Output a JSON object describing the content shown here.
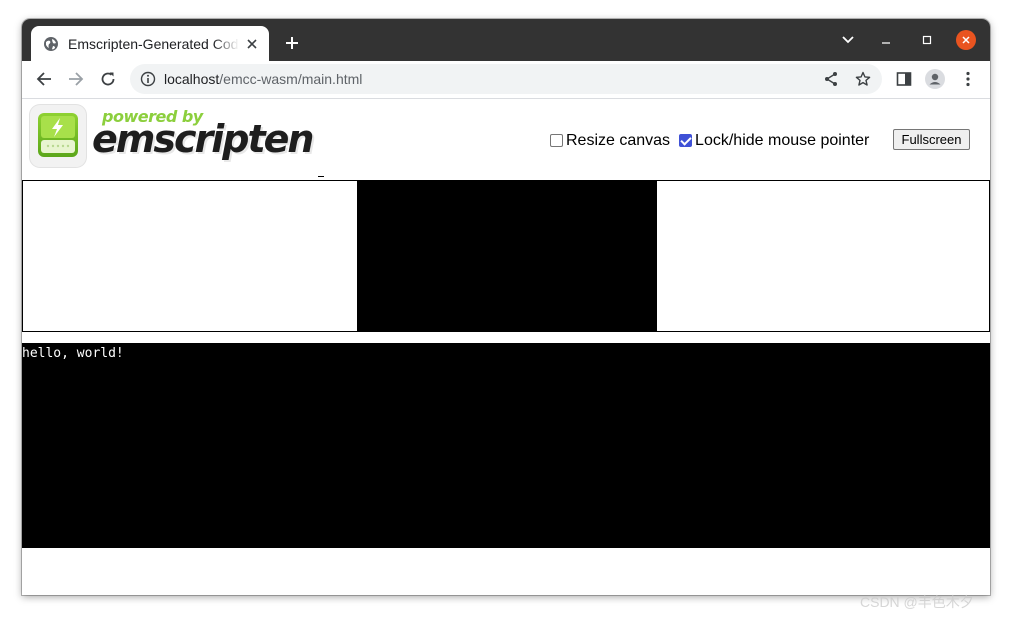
{
  "browser": {
    "tab_title": "Emscripten-Generated Code",
    "url_host": "localhost",
    "url_path": "/emcc-wasm/main.html"
  },
  "icons": {
    "tab": "globe-icon",
    "tab_close": "close-icon",
    "new_tab": "plus-icon",
    "tab_search": "chevron-down-icon",
    "minimize": "minimize-icon",
    "maximize": "maximize-icon",
    "window_close": "close-icon",
    "back": "arrow-left-icon",
    "forward": "arrow-right-icon",
    "reload": "reload-icon",
    "site_info": "info-icon",
    "share": "share-icon",
    "bookmark": "star-icon",
    "side_panel": "side-panel-icon",
    "profile": "profile-icon",
    "menu": "kebab-menu-icon"
  },
  "page": {
    "logo": {
      "powered_by": "powered by",
      "wordmark": "emscripten"
    },
    "controls": {
      "resize_canvas_label": "Resize canvas",
      "resize_canvas_checked": false,
      "lock_pointer_label": "Lock/hide mouse pointer",
      "lock_pointer_checked": true,
      "fullscreen_label": "Fullscreen"
    },
    "output_text": "hello, world!"
  },
  "colors": {
    "tabstrip_bg": "#333333",
    "close_button": "#e95420",
    "logo_green": "#8ccf3d",
    "canvas_bg": "#000000",
    "output_bg": "#000000",
    "checkbox_accent": "#3f51d6"
  },
  "watermark": "CSDN @丰色木夕"
}
